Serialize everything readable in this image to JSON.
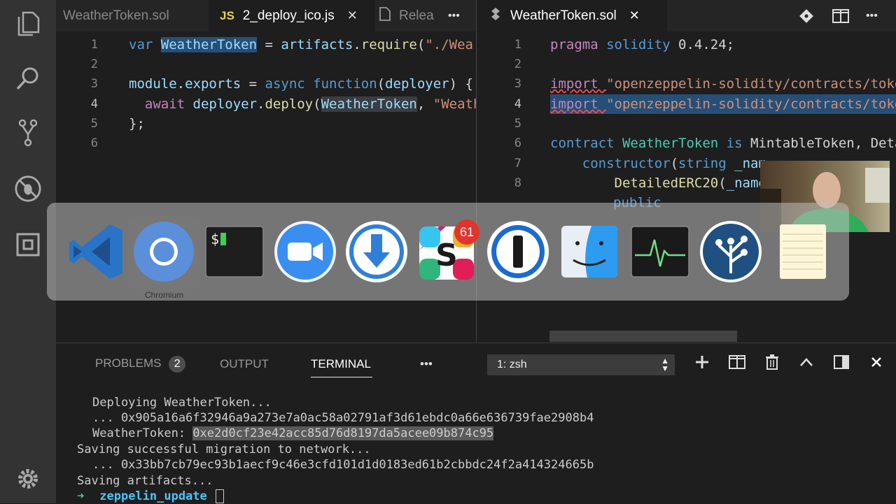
{
  "tabs_left": {
    "tab1": "WeatherToken.sol",
    "tab2_badge": "JS",
    "tab2": "2_deploy_ico.js",
    "tab3": "Relea",
    "more": "•••"
  },
  "tabs_right": {
    "tab1": "WeatherToken.sol"
  },
  "left_editor": {
    "line_numbers": [
      "1",
      "2",
      "3",
      "4",
      "5",
      "6"
    ],
    "l1": {
      "a": "var ",
      "b": "WeatherToken",
      "c": " = ",
      "d": "artifacts",
      "e": ".",
      "f": "require",
      "g": "(",
      "h": "\"./Wea"
    },
    "l3": {
      "a": "module",
      "b": ".",
      "c": "exports",
      "d": " = ",
      "e": "async ",
      "f": "function",
      "g": "(",
      "h": "deployer",
      "i": ") {"
    },
    "l4": {
      "a": "  await ",
      "b": "deployer",
      "c": ".",
      "d": "deploy",
      "e": "(",
      "f": "WeatherToken",
      "g": ", ",
      "h": "\"Weath"
    },
    "l5": "};"
  },
  "right_editor": {
    "line_numbers": [
      "1",
      "2",
      "3",
      "4",
      "5",
      "6",
      "7",
      "8"
    ],
    "l1": {
      "a": "pragma ",
      "b": "solidity ",
      "c": "0.4.24",
      "d": ";"
    },
    "l3": {
      "a": "import ",
      "b": "\"openzeppelin-solidity/contracts/toke"
    },
    "l4": {
      "a": "import ",
      "b": "\"openzeppelin-solidity/contracts/toke"
    },
    "l6": {
      "a": "contract ",
      "b": "WeatherToken ",
      "c": "is ",
      "d": "MintableToken",
      "e": ", Deta"
    },
    "l7": {
      "a": "    constructor",
      "b": "(",
      "c": "string ",
      "d": "_nam"
    },
    "l8": {
      "a": "        DetailedERC20",
      "b": "(",
      "c": "_name"
    },
    "l9": "public"
  },
  "dock": {
    "hover_label": "Chromium",
    "slack_badge": "61",
    "apps": [
      "vscode",
      "chromium",
      "terminal",
      "zoom",
      "downloader",
      "slack",
      "1password",
      "finder",
      "activity-monitor",
      "sourcetree",
      "notes"
    ]
  },
  "panel": {
    "problems_label": "PROBLEMS",
    "problems_count": "2",
    "output_label": "OUTPUT",
    "terminal_label": "TERMINAL",
    "more": "•••",
    "shell_select": "1: zsh"
  },
  "terminal": {
    "t1": "Deploying WeatherToken...",
    "t2": "... 0x905a16a6f32946a9a273e7a0ac58a02791af3d61ebdc0a66e636739fae2908b4",
    "t3a": "WeatherToken: ",
    "t3b": "0xe2d0cf23e42acc85d76d8197da5acee09b874c95",
    "t4": "Saving successful migration to network...",
    "t5": "... 0x33bb7cb79ec93b1aecf9c46e3cfd101d1d0183ed61b2cbbdc24f2a414324665b",
    "t6": "Saving artifacts...",
    "t7a": "➜",
    "t7b": "zeppelin_update"
  }
}
